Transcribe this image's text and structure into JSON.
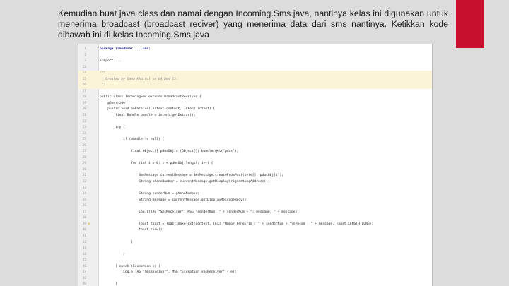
{
  "slide": {
    "accent_color": "#c8102e",
    "caption": "Kemudian buat java class dan namai dengan Incoming.Sms.java, nantinya kelas ini digunakan untuk menerima broadcast (broadcast reciver) yang menerima data dari sms nantinya. Ketikkan kode dibawah ini di kelas Incoming.Sms.java"
  },
  "editor": {
    "lines": [
      {
        "num": "1",
        "text": "package ilmudasar.....sms;",
        "mark": "",
        "style": "kw"
      },
      {
        "num": "2",
        "text": "",
        "mark": "",
        "style": ""
      },
      {
        "num": "3",
        "text": "+import ...",
        "mark": "",
        "style": ""
      },
      {
        "num": "13",
        "text": "",
        "mark": "",
        "style": ""
      },
      {
        "num": "14",
        "text": "/**",
        "mark": "",
        "style": "comment",
        "hl": true
      },
      {
        "num": "15",
        "text": " * Created by Dana Khoirul on 04 Des 15.",
        "mark": "",
        "style": "comment",
        "hl": true
      },
      {
        "num": "16",
        "text": " */",
        "mark": "",
        "style": "comment",
        "hl": true
      },
      {
        "num": "17",
        "text": "",
        "mark": "",
        "style": ""
      },
      {
        "num": "18",
        "text": "public class IncomingSms extends BroadcastReceiver {",
        "mark": "",
        "style": ""
      },
      {
        "num": "19",
        "text": "    @Override",
        "mark": "",
        "style": ""
      },
      {
        "num": "20",
        "text": "    public void onReceive(Context context, Intent intent) {",
        "mark": "",
        "style": ""
      },
      {
        "num": "21",
        "text": "        final Bundle bundle = intent.getExtras();",
        "mark": "",
        "style": ""
      },
      {
        "num": "22",
        "text": "",
        "mark": "",
        "style": ""
      },
      {
        "num": "23",
        "text": "        try {",
        "mark": "",
        "style": ""
      },
      {
        "num": "24",
        "text": "",
        "mark": "",
        "style": ""
      },
      {
        "num": "25",
        "text": "            if (bundle != null) {",
        "mark": "",
        "style": ""
      },
      {
        "num": "26",
        "text": "",
        "mark": "",
        "style": ""
      },
      {
        "num": "27",
        "text": "                final Object[] pdusObj = (Object[]) bundle.get(\"pdus\");",
        "mark": "",
        "style": ""
      },
      {
        "num": "28",
        "text": "",
        "mark": "",
        "style": ""
      },
      {
        "num": "29",
        "text": "                for (int i = 0; i < pdusObj.length; i++) {",
        "mark": "",
        "style": ""
      },
      {
        "num": "30",
        "text": "",
        "mark": "",
        "style": ""
      },
      {
        "num": "31",
        "text": "                    SmsMessage currentMessage = SmsMessage.createFromPdu((byte[]) pdusObj[i]);",
        "mark": "",
        "style": ""
      },
      {
        "num": "32",
        "text": "                    String phoneNumber = currentMessage.getDisplayOriginatingAddress();",
        "mark": "",
        "style": ""
      },
      {
        "num": "33",
        "text": "",
        "mark": "",
        "style": ""
      },
      {
        "num": "34",
        "text": "                    String senderNum = phoneNumber;",
        "mark": "",
        "style": ""
      },
      {
        "num": "35",
        "text": "                    String message = currentMessage.getDisplayMessageBody();",
        "mark": "",
        "style": ""
      },
      {
        "num": "36",
        "text": "",
        "mark": "",
        "style": ""
      },
      {
        "num": "37",
        "text": "                    Log.i(TAG \"SmsReceiver\", MSG \"senderNum: \" + senderNum + \"; message: \" + message);",
        "mark": "",
        "style": ""
      },
      {
        "num": "38",
        "text": "",
        "mark": "",
        "style": ""
      },
      {
        "num": "39",
        "text": "                    Toast toast = Toast.makeText(context, TEXT \"Nomor Pengirim : \" + senderNum + \"\\nPesan : \" + message, Toast.LENGTH_LONG);",
        "mark": "bulb",
        "style": ""
      },
      {
        "num": "40",
        "text": "                    toast.show();",
        "mark": "",
        "style": ""
      },
      {
        "num": "41",
        "text": "",
        "mark": "",
        "style": ""
      },
      {
        "num": "42",
        "text": "                }",
        "mark": "",
        "style": ""
      },
      {
        "num": "43",
        "text": "",
        "mark": "",
        "style": ""
      },
      {
        "num": "44",
        "text": "            }",
        "mark": "",
        "style": ""
      },
      {
        "num": "45",
        "text": "",
        "mark": "",
        "style": ""
      },
      {
        "num": "46",
        "text": "        } catch (Exception e) {",
        "mark": "",
        "style": ""
      },
      {
        "num": "47",
        "text": "            Log.e(TAG \"SmsReceiver\", MSG \"Exception smsReceiver\" + e);",
        "mark": "",
        "style": ""
      },
      {
        "num": "48",
        "text": "",
        "mark": "",
        "style": ""
      },
      {
        "num": "49",
        "text": "        }",
        "mark": "",
        "style": ""
      },
      {
        "num": "50",
        "text": "    }",
        "mark": "",
        "style": ""
      }
    ]
  }
}
